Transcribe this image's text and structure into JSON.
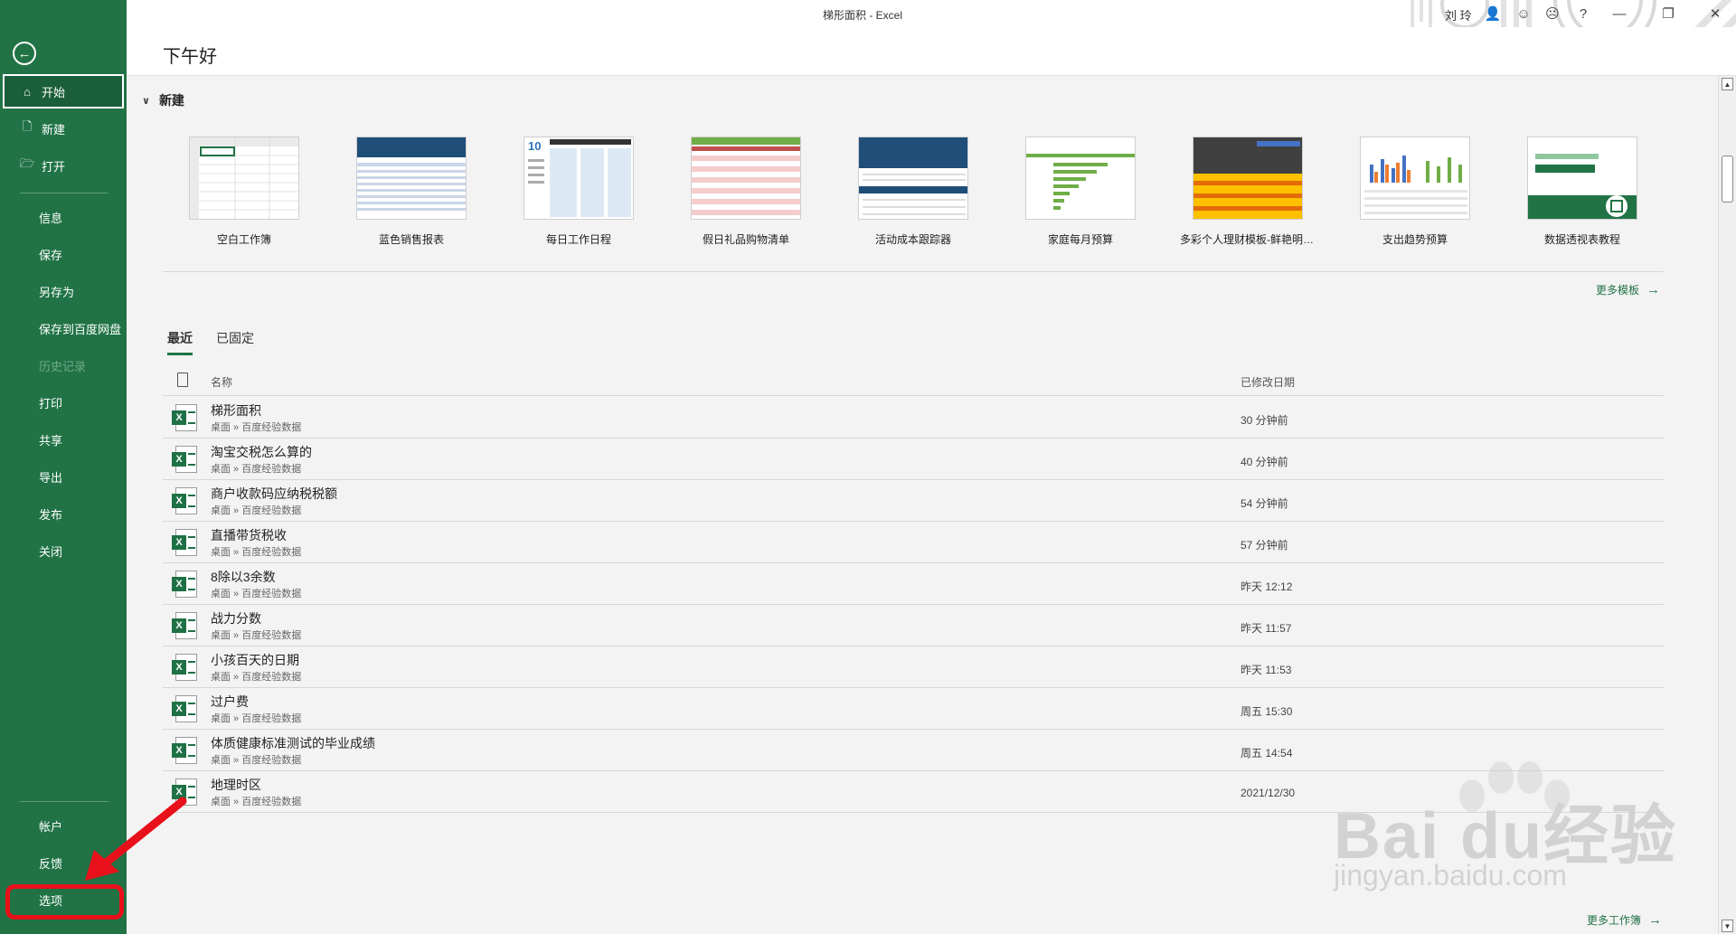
{
  "window": {
    "title": "梯形面积 - Excel",
    "user": "刘 玲"
  },
  "greeting": "下午好",
  "sidebar": {
    "items": [
      {
        "label": "开始",
        "icon": "home-icon"
      },
      {
        "label": "新建",
        "icon": "new-file-icon"
      },
      {
        "label": "打开",
        "icon": "folder-open-icon"
      },
      {
        "label": "信息"
      },
      {
        "label": "保存"
      },
      {
        "label": "另存为"
      },
      {
        "label": "保存到百度网盘"
      },
      {
        "label": "历史记录"
      },
      {
        "label": "打印"
      },
      {
        "label": "共享"
      },
      {
        "label": "导出"
      },
      {
        "label": "发布"
      },
      {
        "label": "关闭"
      }
    ],
    "bottom": [
      {
        "label": "帐户"
      },
      {
        "label": "反馈"
      },
      {
        "label": "选项"
      }
    ]
  },
  "new_section": {
    "title": "新建",
    "templates": [
      {
        "name": "空白工作簿"
      },
      {
        "name": "蓝色销售报表"
      },
      {
        "name": "每日工作日程"
      },
      {
        "name": "假日礼品购物清单"
      },
      {
        "name": "活动成本跟踪器"
      },
      {
        "name": "家庭每月预算"
      },
      {
        "name": "多彩个人理财模板-鲜艳明快..."
      },
      {
        "name": "支出趋势预算"
      },
      {
        "name": "数据透视表教程"
      }
    ],
    "more_templates": "更多模板"
  },
  "recent": {
    "tabs": [
      "最近",
      "已固定"
    ],
    "col_name": "名称",
    "col_date": "已修改日期",
    "files": [
      {
        "name": "梯形面积",
        "path": "桌面 » 百度经验数据",
        "date": "30 分钟前"
      },
      {
        "name": "淘宝交税怎么算的",
        "path": "桌面 » 百度经验数据",
        "date": "40 分钟前"
      },
      {
        "name": "商户收款码应纳税税额",
        "path": "桌面 » 百度经验数据",
        "date": "54 分钟前"
      },
      {
        "name": "直播带货税收",
        "path": "桌面 » 百度经验数据",
        "date": "57 分钟前"
      },
      {
        "name": "8除以3余数",
        "path": "桌面 » 百度经验数据",
        "date": "昨天 12:12"
      },
      {
        "name": "战力分数",
        "path": "桌面 » 百度经验数据",
        "date": "昨天 11:57"
      },
      {
        "name": "小孩百天的日期",
        "path": "桌面 » 百度经验数据",
        "date": "昨天 11:53"
      },
      {
        "name": "过户费",
        "path": "桌面 » 百度经验数据",
        "date": "周五 15:30"
      },
      {
        "name": "体质健康标准测试的毕业成绩",
        "path": "桌面 » 百度经验数据",
        "date": "周五 14:54"
      },
      {
        "name": "地理时区",
        "path": "桌面 » 百度经验数据",
        "date": "2021/12/30"
      }
    ],
    "more_workbooks": "更多工作簿"
  },
  "watermark": {
    "brand": "Bai du经验",
    "url": "jingyan.baidu.com"
  },
  "colors": {
    "accent": "#217346",
    "annotation": "#e8101a"
  }
}
